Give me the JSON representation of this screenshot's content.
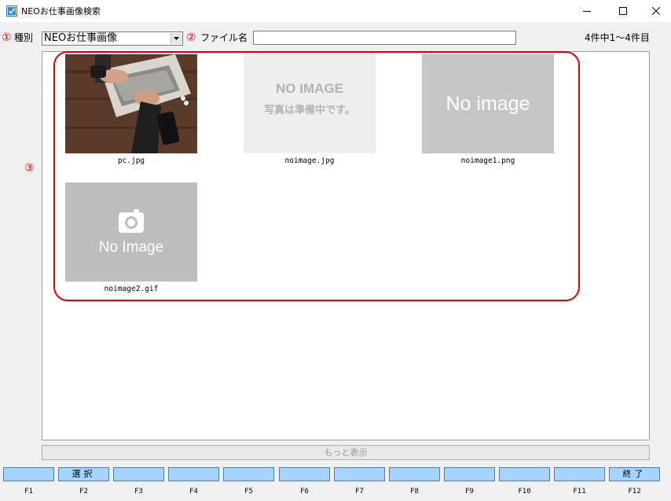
{
  "window": {
    "title": "NEOお仕事画像検索",
    "minimize_icon": "minimize-icon",
    "maximize_icon": "maximize-icon",
    "close_icon": "close-icon"
  },
  "annotations": {
    "one": "①",
    "two": "②",
    "three": "③",
    "color": "#e00000"
  },
  "filter": {
    "type_label": "種別",
    "type_value": "NEOお仕事画像",
    "filename_label": "ファイル名",
    "filename_value": "",
    "result_count": "4件中1～4件目"
  },
  "results": [
    {
      "caption": "pc.jpg",
      "image": "laptop-photo"
    },
    {
      "caption": "noimage.jpg",
      "image_line1": "NO IMAGE",
      "image_line2": "写真は準備中です。"
    },
    {
      "caption": "noimage1.png",
      "image_text": "No image"
    },
    {
      "caption": "noimage2.gif",
      "image_text": "No Image",
      "icon": "camera-icon"
    }
  ],
  "more_button": "もっと表示",
  "fkeys": [
    {
      "key": "F1",
      "label": ""
    },
    {
      "key": "F2",
      "label": "選択"
    },
    {
      "key": "F3",
      "label": ""
    },
    {
      "key": "F4",
      "label": ""
    },
    {
      "key": "F5",
      "label": ""
    },
    {
      "key": "F6",
      "label": ""
    },
    {
      "key": "F7",
      "label": ""
    },
    {
      "key": "F8",
      "label": ""
    },
    {
      "key": "F9",
      "label": ""
    },
    {
      "key": "F10",
      "label": ""
    },
    {
      "key": "F11",
      "label": ""
    },
    {
      "key": "F12",
      "label": "終了"
    }
  ],
  "colors": {
    "fkey_fill": "#a6d4ff",
    "fkey_border": "#4d7fb5",
    "highlight": "#e00000"
  }
}
